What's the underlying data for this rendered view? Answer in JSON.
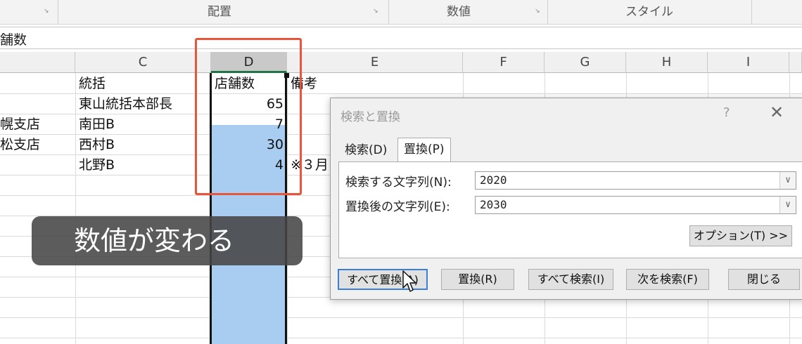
{
  "ribbon": {
    "groups": [
      "配置",
      "数値",
      "スタイル"
    ],
    "launcher_glyph": "↘"
  },
  "formula_bar": {
    "value": "舗数"
  },
  "columns": [
    "C",
    "D",
    "E",
    "F",
    "G",
    "H",
    "I"
  ],
  "rows": [
    {
      "b": "",
      "c": "統括",
      "d": "店舗数",
      "e": "備考"
    },
    {
      "b": "",
      "c": "東山統括本部長",
      "d": "65",
      "e": ""
    },
    {
      "b": "幌支店",
      "c": "南田B",
      "d": "7",
      "e": ""
    },
    {
      "b": "松支店",
      "c": "西村B",
      "d": "30",
      "e": ""
    },
    {
      "b": "",
      "c": "北野B",
      "d": "4",
      "e": "※３月"
    }
  ],
  "caption": "数値が変わる",
  "dialog": {
    "title": "検索と置換",
    "help": "?",
    "close": "✕",
    "tabs": {
      "search": "検索(D)",
      "replace": "置換(P)"
    },
    "find_label": "検索する文字列(N):",
    "find_value": "2020",
    "replace_label": "置換後の文字列(E):",
    "replace_value": "2030",
    "dropdown_glyph": "∨",
    "options_button": "オプション(T) >>",
    "buttons": {
      "replace_all": "すべて置換(A)",
      "replace": "置換(R)",
      "find_all": "すべて検索(I)",
      "find_next": "次を検索(F)",
      "close": "閉じる"
    }
  },
  "colors": {
    "selection": "#a9cdf1",
    "highlight_box": "#e8553a",
    "caption_bg": "#464646"
  }
}
